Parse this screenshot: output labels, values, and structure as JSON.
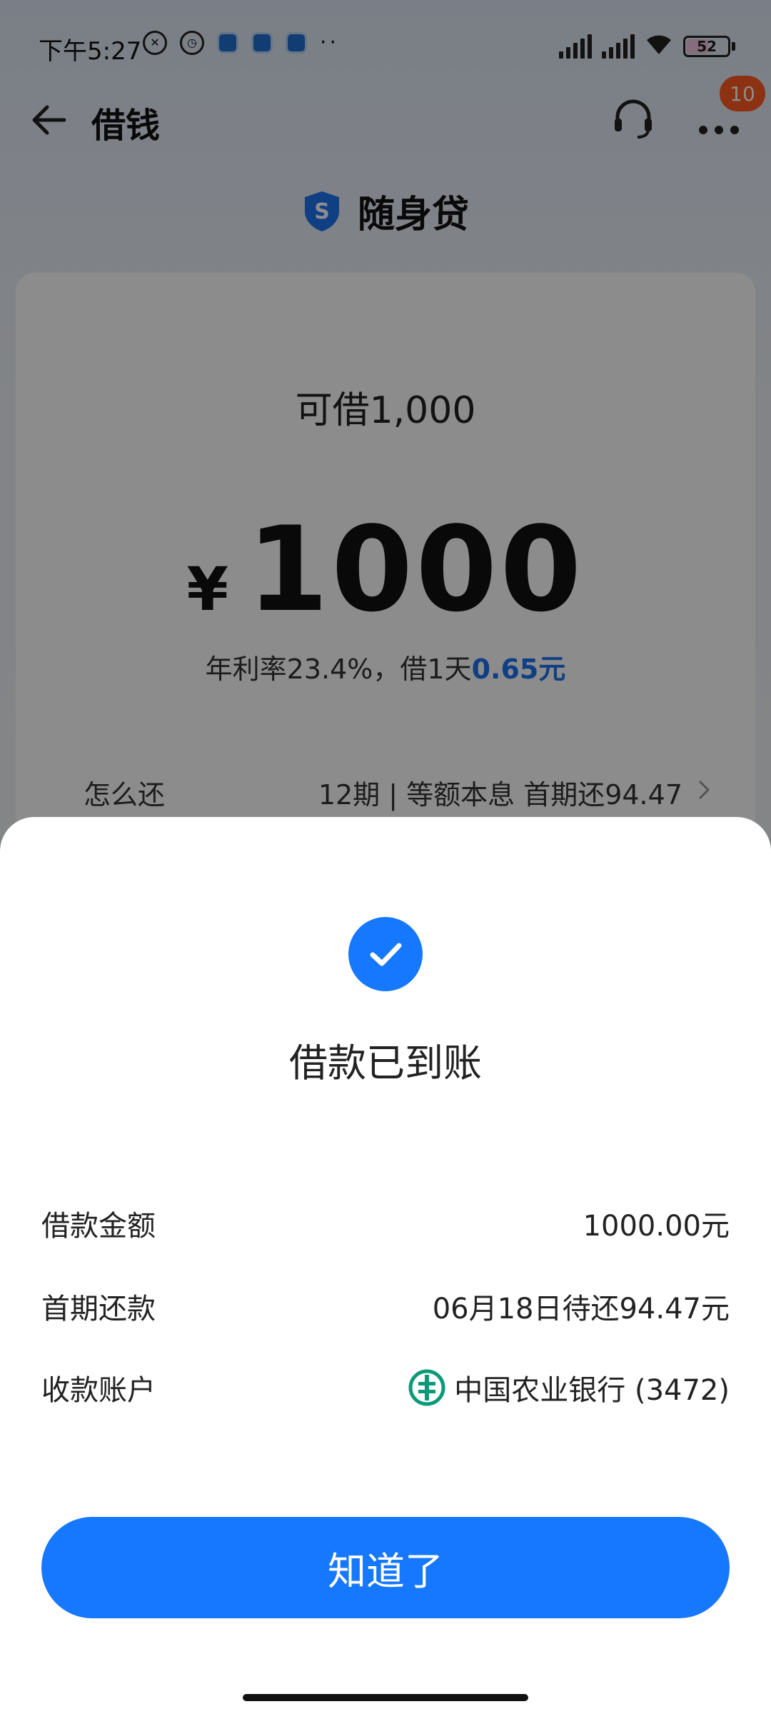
{
  "status_bar": {
    "time": "下午5:27",
    "battery": "52"
  },
  "header": {
    "title": "借钱",
    "badge_count": "10",
    "icons": [
      "back-arrow-icon",
      "headset-icon",
      "more-icon"
    ]
  },
  "brand": {
    "name": "随身贷",
    "logo_letter": "S",
    "icon": "shield-icon"
  },
  "loan_card": {
    "available_label": "可借1,000",
    "currency": "¥",
    "amount": "1000",
    "rate_text": "年利率23.4%，借1天",
    "rate_highlight": "0.65元",
    "repay_label": "怎么还",
    "repay_value": "12期 | 等额本息 首期还94.47"
  },
  "success_sheet": {
    "title": "借款已到账",
    "rows": [
      {
        "label": "借款金额",
        "value": "1000.00元"
      },
      {
        "label": "首期还款",
        "value": "06月18日待还94.47元"
      },
      {
        "label": "收款账户",
        "value": "中国农业银行 (3472)",
        "icon": "abc-bank-icon"
      }
    ],
    "button_label": "知道了"
  },
  "colors": {
    "primary": "#1677ff",
    "badge": "#ff5a1f",
    "rate_highlight": "#1e73f0"
  }
}
